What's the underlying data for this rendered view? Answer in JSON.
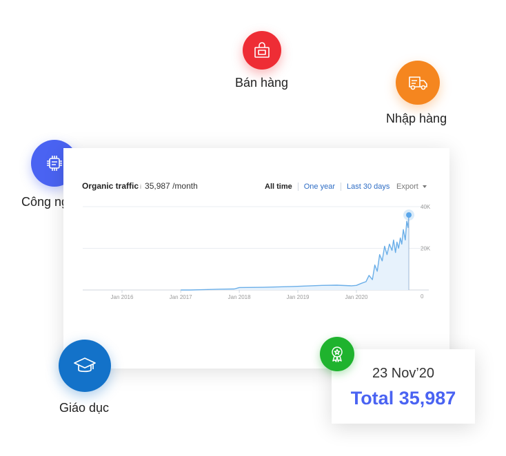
{
  "bubbles": {
    "sales": {
      "label": "Bán hàng",
      "icon": "shopping-bag-icon",
      "color": "#ee2d35"
    },
    "import": {
      "label": "Nhập hàng",
      "icon": "delivery-truck-icon",
      "color": "#f5861f"
    },
    "tech": {
      "label": "Công nghệ",
      "icon": "cpu-chip-icon",
      "color": "#4a63f2"
    },
    "education": {
      "label": "Giáo dục",
      "icon": "graduation-cap-icon",
      "color": "#1372c9"
    },
    "award": {
      "icon": "award-ribbon-icon",
      "color": "#1fb32e"
    }
  },
  "chart_header": {
    "label": "Organic traffic",
    "info_mark": "i",
    "value": "35,987 /month",
    "tabs": [
      "All time",
      "One year",
      "Last 30 days"
    ],
    "export_label": "Export"
  },
  "stat_card": {
    "date": "23 Nov’20",
    "total": "Total 35,987"
  },
  "chart_data": {
    "type": "area",
    "title": "Organic traffic",
    "xlabel": "",
    "ylabel": "",
    "x_ticks": [
      "Jan 2016",
      "Jan 2017",
      "Jan 2018",
      "Jan 2019",
      "Jan 2020"
    ],
    "y_ticks": [
      "0",
      "20K",
      "40K"
    ],
    "ylim": [
      0,
      40000
    ],
    "xlim": [
      "2015-05-01",
      "2020-12-10"
    ],
    "grid": true,
    "line_color": "#6aaee8",
    "fill_color": "#e7f2fc",
    "series": [
      {
        "x": [
          "2017-01-01",
          "2017-03-01",
          "2017-06-01",
          "2017-09-01",
          "2017-12-01",
          "2018-01-01",
          "2018-06-01",
          "2018-12-01",
          "2019-06-01",
          "2019-09-01",
          "2019-12-01",
          "2020-01-01",
          "2020-02-01",
          "2020-03-01",
          "2020-03-20",
          "2020-04-10",
          "2020-04-25",
          "2020-05-10",
          "2020-05-25",
          "2020-06-10",
          "2020-06-25",
          "2020-07-10",
          "2020-07-25",
          "2020-08-10",
          "2020-08-20",
          "2020-09-01",
          "2020-09-10",
          "2020-09-20",
          "2020-10-01",
          "2020-10-10",
          "2020-10-20",
          "2020-11-01",
          "2020-11-10",
          "2020-11-18",
          "2020-11-23"
        ],
        "y": [
          0,
          0,
          200,
          400,
          500,
          1200,
          1300,
          1700,
          2200,
          2300,
          2000,
          2200,
          3200,
          4000,
          7000,
          5000,
          12000,
          9000,
          17000,
          14000,
          21000,
          17000,
          22000,
          19000,
          24000,
          18000,
          23000,
          20000,
          25000,
          22000,
          29000,
          24000,
          33000,
          30000,
          35987
        ]
      }
    ],
    "highlight": {
      "x": "2020-11-23",
      "y": 35987
    }
  }
}
